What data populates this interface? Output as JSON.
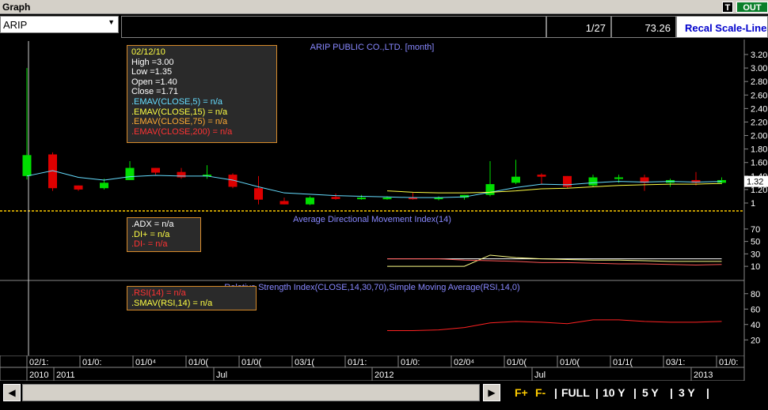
{
  "window": {
    "title": "Graph",
    "t_label": "T",
    "out_label": "OUT"
  },
  "toolbar": {
    "symbol": "ARIP",
    "page": "1/27",
    "price": "73.26",
    "recal_label": "Recal Scale-Linea"
  },
  "colors": {
    "bull": "#00dd00",
    "bear": "#dd0000",
    "ema5": "#66ddff",
    "ema15": "#ffff44",
    "rsi": "#ff2222",
    "grid_label": "#8888ff"
  },
  "info_price": {
    "date": "02/12/10",
    "high": "High  =3.00",
    "low": "Low  =1.35",
    "open": "Open  =1.40",
    "close": "Close  =1.71",
    "emav5": ".EMAV(CLOSE,5)   = n/a",
    "emav15": ".EMAV(CLOSE,15)   = n/a",
    "emav75": ".EMAV(CLOSE,75)   = n/a",
    "emav200": ".EMAV(CLOSE,200)   = n/a"
  },
  "info_adx": {
    "adx": ".ADX   = n/a",
    "diplus": ".DI+   = n/a",
    "diminus": ".DI-   = n/a"
  },
  "info_rsi": {
    "rsi": ".RSI(14)   = n/a",
    "smav": ".SMAV(RSI,14)   = n/a"
  },
  "bottom": {
    "scroll_left": "◀",
    "scroll_right": "▶",
    "fplus": "F+",
    "fminus": "F-",
    "full": "FULL",
    "y10": "10 Y",
    "y5": "5 Y",
    "y3": "3 Y"
  },
  "chart_data": [
    {
      "type": "candlestick",
      "title": "ARIP PUBLIC CO.,LTD. [month]",
      "y_ticks": [
        "3.20",
        "3.00",
        "2.80",
        "2.60",
        "2.40",
        "2.20",
        "2.00",
        "1.80",
        "1.60",
        "1.40",
        "1.20",
        "1"
      ],
      "ylim": [
        1.0,
        3.2
      ],
      "last_value": "1.32",
      "candles": [
        {
          "open": 1.4,
          "high": 3.0,
          "low": 1.35,
          "close": 1.71
        },
        {
          "open": 1.72,
          "high": 1.75,
          "low": 1.18,
          "close": 1.22
        },
        {
          "open": 1.26,
          "high": 1.26,
          "low": 1.18,
          "close": 1.2
        },
        {
          "open": 1.22,
          "high": 1.36,
          "low": 1.2,
          "close": 1.3
        },
        {
          "open": 1.34,
          "high": 1.62,
          "low": 1.34,
          "close": 1.52
        },
        {
          "open": 1.52,
          "high": 1.52,
          "low": 1.42,
          "close": 1.45
        },
        {
          "open": 1.46,
          "high": 1.52,
          "low": 1.36,
          "close": 1.38
        },
        {
          "open": 1.4,
          "high": 1.56,
          "low": 1.36,
          "close": 1.42
        },
        {
          "open": 1.42,
          "high": 1.44,
          "low": 1.22,
          "close": 1.24
        },
        {
          "open": 1.22,
          "high": 1.4,
          "low": 0.98,
          "close": 1.05
        },
        {
          "open": 1.03,
          "high": 1.08,
          "low": 0.98,
          "close": 0.98
        },
        {
          "open": 0.98,
          "high": 1.1,
          "low": 0.97,
          "close": 1.08
        },
        {
          "open": 1.09,
          "high": 1.14,
          "low": 1.05,
          "close": 1.06
        },
        {
          "open": 1.06,
          "high": 1.12,
          "low": 1.05,
          "close": 1.08
        },
        {
          "open": 1.07,
          "high": 1.1,
          "low": 1.05,
          "close": 1.08
        },
        {
          "open": 1.08,
          "high": 1.15,
          "low": 1.05,
          "close": 1.06
        },
        {
          "open": 1.06,
          "high": 1.1,
          "low": 1.04,
          "close": 1.08
        },
        {
          "open": 1.08,
          "high": 1.12,
          "low": 1.05,
          "close": 1.12
        },
        {
          "open": 1.12,
          "high": 1.62,
          "low": 1.1,
          "close": 1.28
        },
        {
          "open": 1.3,
          "high": 1.64,
          "low": 1.28,
          "close": 1.39
        },
        {
          "open": 1.42,
          "high": 1.44,
          "low": 1.28,
          "close": 1.39
        },
        {
          "open": 1.4,
          "high": 1.4,
          "low": 1.22,
          "close": 1.24
        },
        {
          "open": 1.26,
          "high": 1.42,
          "low": 1.24,
          "close": 1.38
        },
        {
          "open": 1.38,
          "high": 1.42,
          "low": 1.3,
          "close": 1.38
        },
        {
          "open": 1.38,
          "high": 1.42,
          "low": 1.18,
          "close": 1.3
        },
        {
          "open": 1.3,
          "high": 1.36,
          "low": 1.24,
          "close": 1.34
        },
        {
          "open": 1.34,
          "high": 1.46,
          "low": 1.26,
          "close": 1.3
        },
        {
          "open": 1.3,
          "high": 1.38,
          "low": 1.28,
          "close": 1.34
        }
      ],
      "ema5": [
        1.4,
        1.48,
        1.38,
        1.34,
        1.39,
        1.41,
        1.4,
        1.4,
        1.34,
        1.24,
        1.15,
        1.13,
        1.11,
        1.1,
        1.09,
        1.08,
        1.08,
        1.09,
        1.16,
        1.23,
        1.28,
        1.27,
        1.3,
        1.32,
        1.31,
        1.32,
        1.31,
        1.32
      ],
      "ema15": [
        null,
        null,
        null,
        null,
        null,
        null,
        null,
        null,
        null,
        null,
        null,
        null,
        null,
        null,
        1.18,
        1.16,
        1.15,
        1.15,
        1.16,
        1.18,
        1.21,
        1.22,
        1.24,
        1.26,
        1.27,
        1.28,
        1.28,
        1.29
      ]
    },
    {
      "type": "line",
      "title": "Average Directional Movement Index(14)",
      "y_ticks": [
        "70",
        "50",
        "30",
        "10"
      ],
      "ylim": [
        0,
        80
      ],
      "series": [
        {
          "name": ".ADX",
          "start": 14,
          "values": [
            22,
            22,
            22,
            22,
            22,
            22,
            22,
            22,
            22,
            22,
            22,
            22,
            22,
            22
          ]
        },
        {
          "name": ".DI+",
          "start": 14,
          "values": [
            10,
            10,
            10,
            10,
            28,
            24,
            22,
            21,
            20,
            20,
            19,
            18,
            18,
            18
          ]
        },
        {
          "name": ".DI-",
          "start": 14,
          "values": [
            22,
            22,
            22,
            20,
            19,
            18,
            16,
            16,
            15,
            14,
            14,
            13,
            12,
            13
          ]
        }
      ]
    },
    {
      "type": "line",
      "title": "Relative Strength Index(CLOSE,14,30,70),Simple Moving Average(RSI,14,0)",
      "y_ticks": [
        "80",
        "60",
        "40",
        "20"
      ],
      "ylim": [
        10,
        90
      ],
      "series": [
        {
          "name": ".RSI(14)",
          "start": 14,
          "values": [
            32,
            32,
            33,
            36,
            42,
            44,
            43,
            41,
            46,
            46,
            44,
            43,
            43,
            44
          ]
        }
      ]
    }
  ],
  "x_axis": {
    "top_ticks": [
      "02/1:",
      "01/0:",
      "01/0⁴",
      "01/0(",
      "01/0(",
      "03/1(",
      "01/1:",
      "01/0:",
      "02/0⁴",
      "01/0(",
      "01/0(",
      "01/1(",
      "03/1:",
      "01/0:"
    ],
    "bottom_labels": [
      "2010",
      "2011",
      "Jul",
      "2012",
      "Jul",
      "2013"
    ]
  }
}
